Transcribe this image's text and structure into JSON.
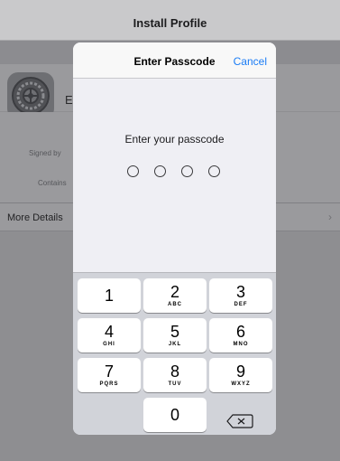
{
  "background": {
    "navbar_title": "Install Profile",
    "profile_name_fragment": "E",
    "signed_by_label": "Signed by",
    "contains_label": "Contains",
    "more_details_label": "More Details",
    "chevron": "›"
  },
  "modal": {
    "title": "Enter Passcode",
    "cancel_label": "Cancel",
    "prompt": "Enter your passcode",
    "passcode_length": 4
  },
  "keypad": {
    "keys": [
      {
        "digit": "1",
        "letters": ""
      },
      {
        "digit": "2",
        "letters": "ABC"
      },
      {
        "digit": "3",
        "letters": "DEF"
      },
      {
        "digit": "4",
        "letters": "GHI"
      },
      {
        "digit": "5",
        "letters": "JKL"
      },
      {
        "digit": "6",
        "letters": "MNO"
      },
      {
        "digit": "7",
        "letters": "PQRS"
      },
      {
        "digit": "8",
        "letters": "TUV"
      },
      {
        "digit": "9",
        "letters": "WXYZ"
      },
      {
        "digit": "0",
        "letters": ""
      }
    ],
    "delete_icon": "backspace-icon"
  },
  "colors": {
    "accent": "#1a7cf5",
    "dim_overlay": "#8e8e91",
    "keypad_bg": "#d1d3d9"
  }
}
